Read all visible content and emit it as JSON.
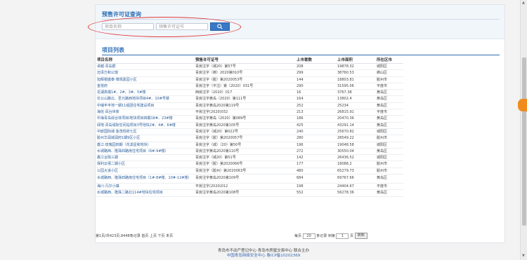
{
  "search": {
    "title": "预售许可证查询",
    "project_placeholder": "项目名称",
    "permit_placeholder": "预售许可证号"
  },
  "list": {
    "title": "项目列表",
    "headers": [
      "项目名称",
      "预售许可证号",
      "上市套数",
      "上市面积",
      "所在区市"
    ],
    "rows": [
      [
        "卓越·青岛郡",
        "青房注字（城20）第57号",
        "208",
        "19878.32",
        "城阳区"
      ],
      [
        "迈泽万和公馆",
        "青房注字（崂）2020第010号",
        "299",
        "38760.53",
        "崂山区"
      ],
      [
        "旭辉银盛泰·博观嘉园小区",
        "青房注字（胶）第2020053号",
        "144",
        "18803.81",
        "胶州市"
      ],
      [
        "金悦府",
        "青房注字（平注）第（2020）031号",
        "290",
        "31595.06",
        "平度市"
      ],
      [
        "龙湖高端1#、2#、3#、5#楼",
        "西房注字（2020）017",
        "16",
        "3767.38",
        "黄岛区"
      ],
      [
        "伦公山路北、圣元路西地块项目4#、10#号楼",
        "青房注字黄岛（2020）第111号",
        "164",
        "13802.4",
        "黄岛区"
      ],
      [
        "中瑞丰丰地一期11组团住宅建设项目",
        "青房注字黄岛2020第119号",
        "252",
        "25234",
        "黄岛区"
      ],
      [
        "海信·凤台世家",
        "平房注字(2020)032",
        "213",
        "26815.91",
        "平度市"
      ],
      [
        "中海青岛综合体项目I地块项目四期18#、23#楼",
        "青房注字黄岛（2020）第089号",
        "186",
        "20470.36",
        "黄岛区"
      ],
      [
        "绿地·青岛城际空间站项目3号地块2#、4#、6#楼",
        "青房注字黄岛2020第105号",
        "425",
        "43291.14",
        "黄岛区"
      ],
      [
        "中欧国际城·金茂悦府七区",
        "青房注字（城20）第022号",
        "240",
        "25670.82",
        "城阳区"
      ],
      [
        "胶州华润城润府1期9区小区",
        "青房注字（胶）第2020057号",
        "280",
        "28549.22",
        "胶州市"
      ],
      [
        "鑫江·玫瑰园四期（花漾星和地块）",
        "青房注字（城）（20）第50号",
        "196",
        "19048.58",
        "城阳区"
      ],
      [
        "水城路西、隆珠四路南住宅项目（6#-9#楼）",
        "青房注字黄岛2020第110号",
        "272",
        "30550.04",
        "黄岛区"
      ],
      [
        "鑫江合院三期",
        "青房注字（城20）第51号",
        "142",
        "26436.52",
        "城阳区"
      ],
      [
        "保利云禧二期小区",
        "青房注字（胶）第2020066号",
        "177",
        "18088.2",
        "胶州市"
      ],
      [
        "公园大道小区",
        "青房注字（胶州）第2020063号",
        "480",
        "65279.73",
        "胶州市"
      ],
      [
        "水城路西、隆珠四路南住宅项目（1#-8#楼、10#-12#楼）",
        "青房注字黄岛2020第109号",
        "684",
        "69767.66",
        "黄岛区"
      ],
      [
        "海川·凡尔小镇",
        "平房注字(2020)012",
        "198",
        "24404.67",
        "平度市"
      ],
      [
        "水城路西、隆珠二路北114#地块住宅项目",
        "青房注字黄岛2020第108号",
        "552",
        "56278.36",
        "黄岛区"
      ]
    ]
  },
  "pager": {
    "summary": "第1页/共423页,8448条记录",
    "first": "首页",
    "prev": "上页",
    "next": "下页",
    "last": "末页",
    "per_page_label_pre": "每页",
    "per_page_value": "20",
    "per_page_label_post": "条记录",
    "goto_label_pre": "到第",
    "goto_value": "1",
    "goto_label_post": "页",
    "goto_button": "转到"
  },
  "footer": {
    "line1": "青岛市不动产登记中心  青岛市房屋交易中心  联合主办",
    "line2": "中国青岛网络安全中心  鲁ICP备10202369"
  },
  "colors": {
    "accent": "#2f6fb4",
    "highlight_circle": "#e03a3a",
    "float_tab": "#f08c1e"
  }
}
